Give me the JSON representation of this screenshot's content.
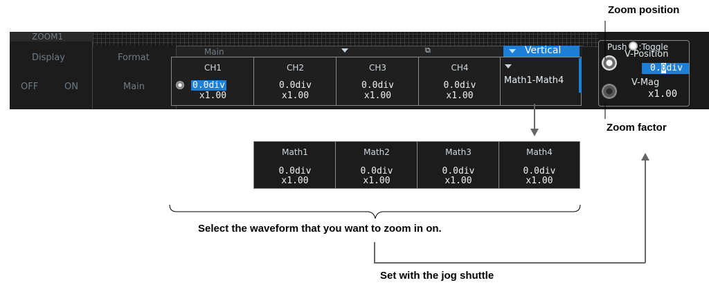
{
  "labels": {
    "zoom_position": "Zoom position",
    "zoom_factor": "Zoom factor",
    "select_waveform": "Select the waveform that you want to zoom in on.",
    "set_with_jog": "Set with the jog shuttle"
  },
  "menu": {
    "title": "ZOOM1",
    "display_label": "Display",
    "display_off": "OFF",
    "display_on": "ON",
    "format_label": "Format",
    "format_value": "Main",
    "main_tab": "Main",
    "vertical_label": "Vertical"
  },
  "channels": [
    {
      "name": "CH1",
      "pos": "0.0div",
      "mag": "x1.00"
    },
    {
      "name": "CH2",
      "pos": "0.0div",
      "mag": "x1.00"
    },
    {
      "name": "CH3",
      "pos": "0.0div",
      "mag": "x1.00"
    },
    {
      "name": "CH4",
      "pos": "0.0div",
      "mag": "x1.00"
    }
  ],
  "math_group_label": "Math1-Math4",
  "math": [
    {
      "name": "Math1",
      "pos": "0.0div",
      "mag": "x1.00"
    },
    {
      "name": "Math2",
      "pos": "0.0div",
      "mag": "x1.00"
    },
    {
      "name": "Math3",
      "pos": "0.0div",
      "mag": "x1.00"
    },
    {
      "name": "Math4",
      "pos": "0.0div",
      "mag": "x1.00"
    }
  ],
  "knob_panel": {
    "push_prefix": "Push",
    "push_suffix": ":Toggle",
    "v_position_label": "V-Position",
    "v_position_value_pre": "0.",
    "v_position_value_cursor": "0",
    "v_position_value_post": "div",
    "v_mag_label": "V-Mag",
    "v_mag_value": "x1.00"
  },
  "colors": {
    "accent": "#1e7fd8",
    "background": "#1a1a1a",
    "dim_text": "#6f7c86"
  }
}
